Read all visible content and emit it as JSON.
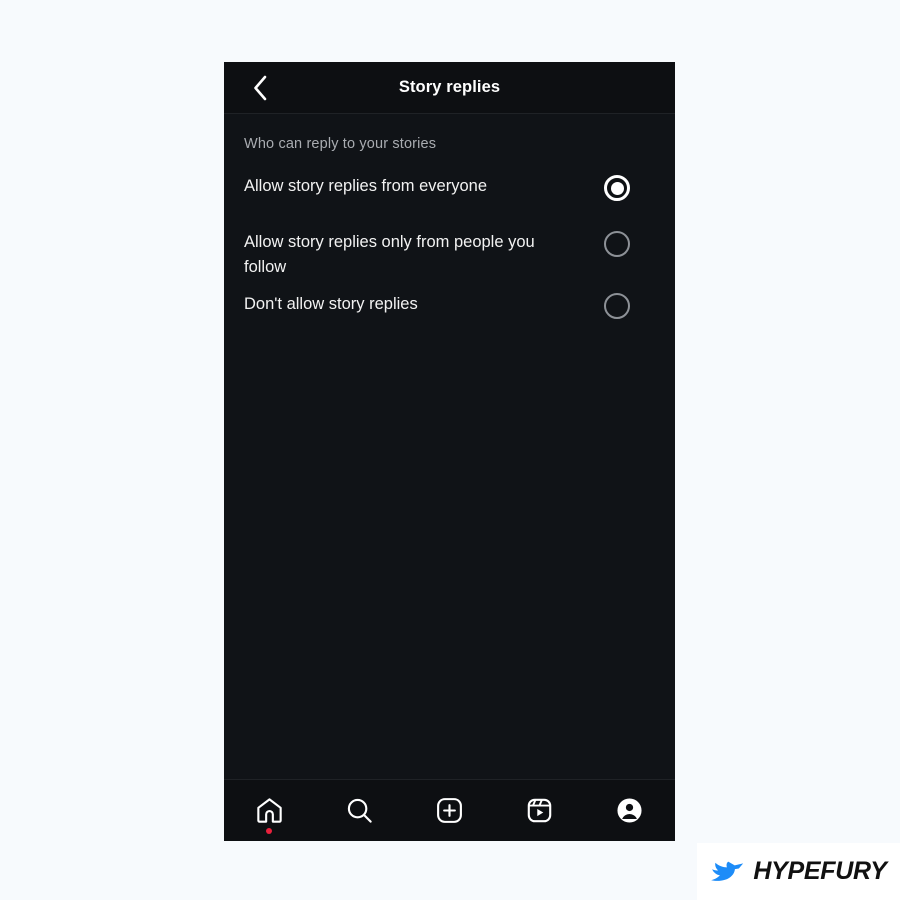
{
  "theme": {
    "page_background": "#f7fafd",
    "panel_background": "#0e1114",
    "header_background": "#0d0f12",
    "body_background": "#101317",
    "divider": "#1f2226",
    "primary_text": "#f2f2f2",
    "muted_text": "#a9acb1",
    "accent_selected": "#ffffff",
    "radio_off": "#8d9197",
    "notification_dot": "#e8213c",
    "brand_blue": "#1d8cf8"
  },
  "header": {
    "back_icon": "chevron-left-icon",
    "title": "Story replies"
  },
  "main": {
    "section_label": "Who can reply to your stories",
    "options": [
      {
        "label": "Allow story replies from everyone",
        "selected": true
      },
      {
        "label": "Allow story replies only from people you follow",
        "selected": false
      },
      {
        "label": "Don't allow story replies",
        "selected": false
      }
    ]
  },
  "bottom_nav": {
    "items": [
      {
        "name": "home",
        "icon": "home-icon",
        "active": true,
        "has_dot": true
      },
      {
        "name": "search",
        "icon": "search-icon",
        "active": false,
        "has_dot": false
      },
      {
        "name": "create",
        "icon": "plus-square-icon",
        "active": false,
        "has_dot": false
      },
      {
        "name": "reels",
        "icon": "reels-icon",
        "active": false,
        "has_dot": false
      },
      {
        "name": "profile",
        "icon": "profile-avatar-icon",
        "active": false,
        "has_dot": false
      }
    ]
  },
  "watermark": {
    "icon": "hypefury-bird-logo",
    "text": "HYPEFURY"
  }
}
